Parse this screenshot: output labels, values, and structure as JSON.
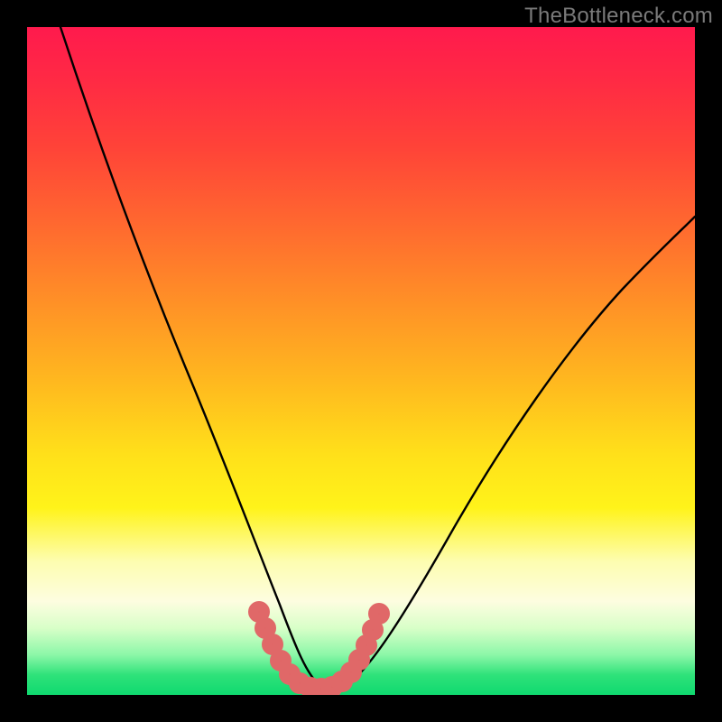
{
  "watermark": "TheBottleneck.com",
  "chart_data": {
    "type": "line",
    "title": "",
    "xlabel": "",
    "ylabel": "",
    "xlim": [
      0,
      1
    ],
    "ylim": [
      0,
      1
    ],
    "grid": false,
    "legend": false,
    "series": [
      {
        "name": "black-v-curve",
        "color": "#000000",
        "x": [
          0.05,
          0.1,
          0.15,
          0.2,
          0.25,
          0.3,
          0.33,
          0.36,
          0.38,
          0.4,
          0.42,
          0.45,
          0.48,
          0.5,
          0.55,
          0.6,
          0.65,
          0.7,
          0.75,
          0.8,
          0.85,
          0.9,
          0.95,
          1.0
        ],
        "y": [
          1.0,
          0.88,
          0.75,
          0.62,
          0.49,
          0.35,
          0.25,
          0.16,
          0.1,
          0.05,
          0.02,
          0.0,
          0.02,
          0.06,
          0.12,
          0.2,
          0.28,
          0.35,
          0.42,
          0.48,
          0.54,
          0.59,
          0.63,
          0.68
        ]
      },
      {
        "name": "pink-u-overlay",
        "color": "#e26a6a",
        "x": [
          0.345,
          0.355,
          0.365,
          0.375,
          0.385,
          0.395,
          0.405,
          0.415,
          0.425,
          0.435,
          0.445,
          0.455,
          0.465,
          0.475,
          0.485,
          0.495
        ],
        "y": [
          0.125,
          0.095,
          0.07,
          0.05,
          0.035,
          0.025,
          0.02,
          0.018,
          0.018,
          0.02,
          0.028,
          0.042,
          0.06,
          0.08,
          0.1,
          0.12
        ]
      }
    ],
    "annotations": [
      {
        "text": "TheBottleneck.com",
        "position": "top-right",
        "color": "#7a7a7a"
      }
    ]
  }
}
